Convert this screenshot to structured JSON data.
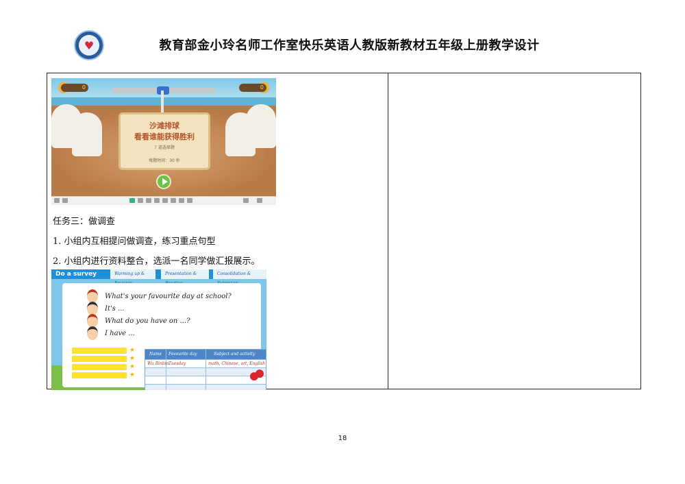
{
  "header": {
    "title": "教育部金小玲名师工作室快乐英语人教版新教材五年级上册教学设计"
  },
  "game_screenshot": {
    "score_left": "0",
    "score_right": "0",
    "line1": "沙滩排球",
    "line2": "看看谁能获得胜利",
    "hint": "7 道选择题",
    "time_text": "每题时间：30 秒"
  },
  "task": {
    "heading": "任务三：做调查",
    "step1": "1. 小组内互相提问做调查，练习重点句型",
    "step2": "2. 小组内进行资料整合，选派一名同学做汇报展示。"
  },
  "survey_screenshot": {
    "title": "Do a survey",
    "tabs": [
      "Warming up & Revision",
      "Presentation & Practice",
      "Consolidation & Extension"
    ],
    "lines": [
      "What's your favourite day at school?",
      "It's ...",
      "What do you have on ...?",
      "I have ..."
    ],
    "table_headers": [
      "Name",
      "Favourite day",
      "Subject and activity"
    ],
    "table_row": [
      "Wu Binbin",
      "Tuesday",
      "math, Chinese, art, English"
    ],
    "tags": [
      "",
      "",
      "",
      ""
    ]
  },
  "page": {
    "number": "18"
  }
}
